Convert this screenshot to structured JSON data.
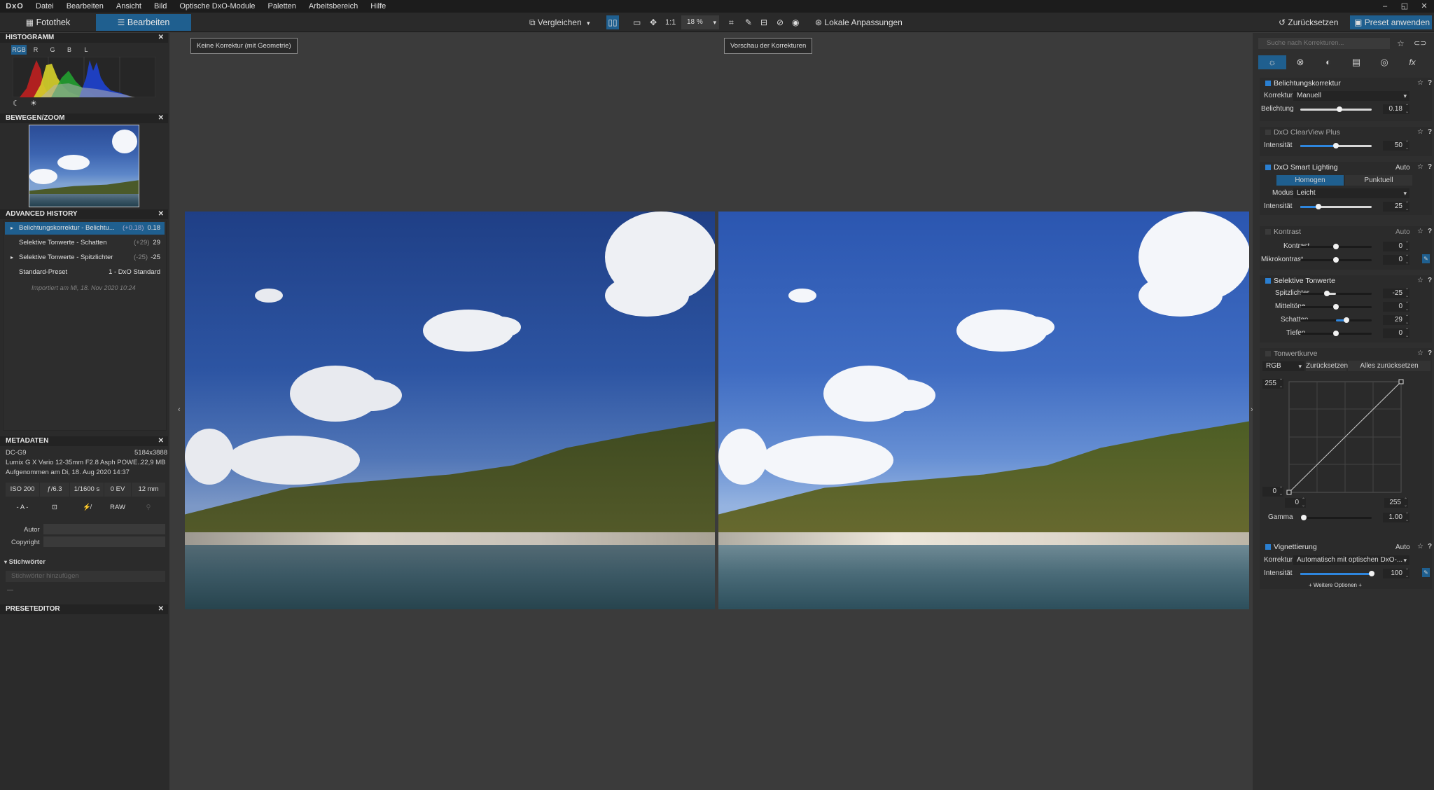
{
  "app": {
    "logo": "DxO"
  },
  "menu": [
    "Datei",
    "Bearbeiten",
    "Ansicht",
    "Bild",
    "Optische DxO-Module",
    "Paletten",
    "Arbeitsbereich",
    "Hilfe"
  ],
  "window_controls": [
    "–",
    "◱",
    "✕"
  ],
  "toolbar": {
    "tab_library": "Fotothek",
    "tab_edit": "Bearbeiten",
    "compare": "Vergleichen",
    "one_to_one": "1:1",
    "zoom": "18 %",
    "local_adjust": "Lokale Anpassungen",
    "reset": "Zurücksetzen",
    "apply_preset": "Preset anwenden"
  },
  "viewer": {
    "left_label": "Keine Korrektur (mit Geometrie)",
    "right_label": "Vorschau der Korrekturen"
  },
  "left": {
    "histogram": {
      "title": "HISTOGRAMM",
      "channels": [
        "RGB",
        "R",
        "G",
        "B",
        "L"
      ],
      "close": "✕"
    },
    "navigator": {
      "title": "BEWEGEN/ZOOM",
      "close": "✕"
    },
    "history": {
      "title": "ADVANCED HISTORY",
      "close": "✕",
      "items": [
        {
          "arrow": "▸",
          "label": "Belichtungskorrektur - Belichtu...",
          "delta": "(+0.18)",
          "value": "0.18"
        },
        {
          "arrow": "",
          "label": "Selektive Tonwerte - Schatten",
          "delta": "(+29)",
          "value": "29"
        },
        {
          "arrow": "▸",
          "label": "Selektive Tonwerte - Spitzlichter",
          "delta": "(-25)",
          "value": "-25"
        },
        {
          "arrow": "",
          "label": "Standard-Preset",
          "delta": "",
          "value": "1 - DxO Standard"
        }
      ],
      "imported": "Importiert am Mi, 18. Nov 2020 10:24"
    },
    "metadata": {
      "title": "METADATEN",
      "close": "✕",
      "camera": "DC-G9",
      "dimensions": "5184x3888",
      "lens": "Lumix G X Vario 12-35mm F2.8 Asph POWE...",
      "size": "22,9 MB",
      "taken": "Aufgenommen am Di, 18. Aug 2020 14:37",
      "iso": "ISO 200",
      "aperture": "ƒ/6.3",
      "shutter": "1/1600 s",
      "ev": "0 EV",
      "focal": "12 mm",
      "raw": "RAW",
      "af": "- A -",
      "author_label": "Autor",
      "copyright_label": "Copyright",
      "keywords_title": "Stichwörter",
      "keywords_placeholder": "Stichwörter hinzufügen",
      "dash": "—"
    },
    "preset_editor": {
      "title": "PRESETEDITOR",
      "close": "✕"
    }
  },
  "right": {
    "search_placeholder": "Suche nach Korrekturen...",
    "tabs_icons": [
      "sun-icon",
      "color-icon",
      "detail-icon",
      "geometry-icon",
      "local-icon",
      "fx-icon"
    ],
    "fx": "fx",
    "exposure": {
      "title": "Belichtungskorrektur",
      "corr_label": "Korrektur",
      "corr_value": "Manuell",
      "exp_label": "Belichtung",
      "exp_value": "0.18",
      "exp_level": 0.55
    },
    "clearview": {
      "title": "DxO ClearView Plus",
      "int_label": "Intensität",
      "int_value": "50",
      "int_level": 0.5
    },
    "smartlight": {
      "title": "DxO Smart Lighting",
      "auto": "Auto",
      "mode_a": "Homogen",
      "mode_b": "Punktuell",
      "modus_label": "Modus",
      "modus_value": "Leicht",
      "int_label": "Intensität",
      "int_value": "25",
      "int_level": 0.25
    },
    "contrast": {
      "title": "Kontrast",
      "auto": "Auto",
      "k_label": "Kontrast",
      "k_value": "0",
      "m_label": "Mikrokontrast",
      "m_value": "0"
    },
    "selective": {
      "title": "Selektive Tonwerte",
      "h_label": "Spitzlichter",
      "h_value": "-25",
      "m_label": "Mitteltöne",
      "m_value": "0",
      "s_label": "Schatten",
      "s_value": "29",
      "t_label": "Tiefen",
      "t_value": "0"
    },
    "curve": {
      "title": "Tonwertkurve",
      "channel": "RGB",
      "reset": "Zurücksetzen",
      "reset_all": "Alles zurücksetzen",
      "top": "255",
      "left_bottom": "0",
      "x0": "0",
      "x255": "255",
      "gamma_label": "Gamma",
      "gamma_value": "1.00"
    },
    "vignette": {
      "title": "Vignettierung",
      "auto": "Auto",
      "corr_label": "Korrektur",
      "corr_value": "Automatisch mit optischen DxO-...",
      "int_label": "Intensität",
      "int_value": "100",
      "int_level": 1.0,
      "more": "+ Weitere Optionen +"
    }
  },
  "colors": {
    "accent": "#2e86de",
    "tab_active": "#1f5f8f"
  }
}
